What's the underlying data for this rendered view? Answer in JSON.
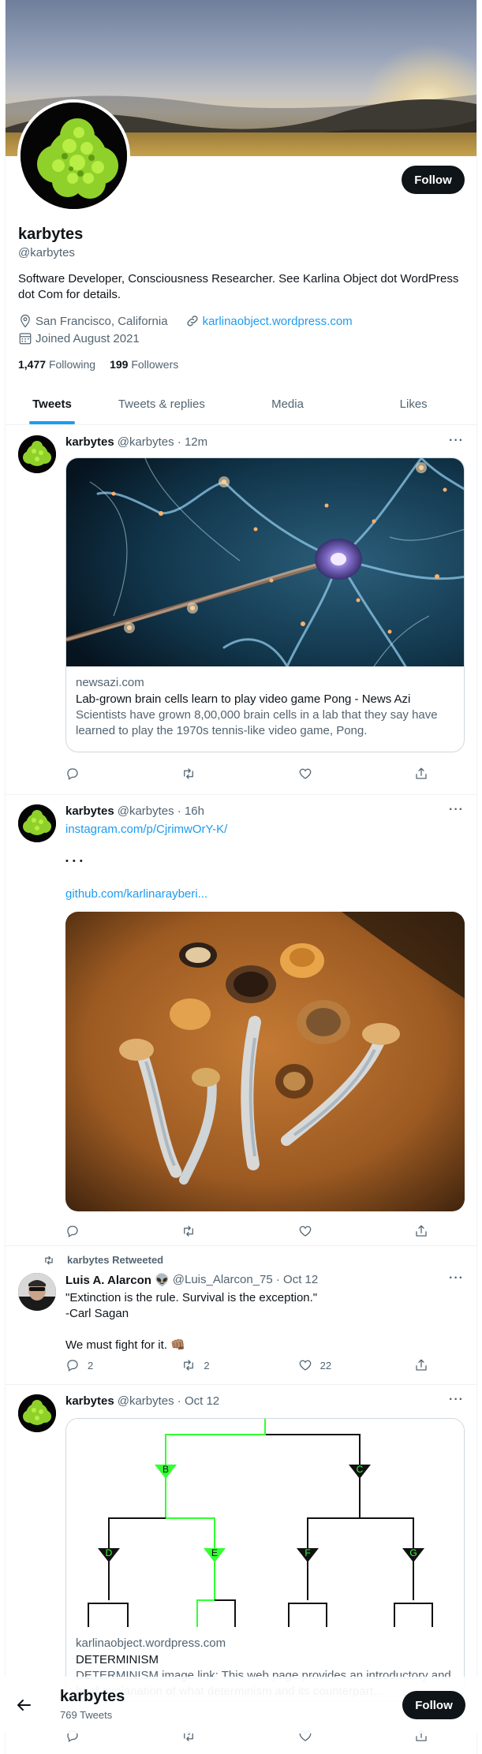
{
  "profile": {
    "name": "karbytes",
    "handle": "@karbytes",
    "bio": "Software Developer, Consciousness Researcher. See Karlina Object dot WordPress dot Com for details.",
    "location": "San Francisco, California",
    "website": "karlinaobject.wordpress.com",
    "joined": "Joined August 2021",
    "following_count": "1,477",
    "following_label": "Following",
    "followers_count": "199",
    "followers_label": "Followers",
    "follow_label": "Follow"
  },
  "tabs": [
    "Tweets",
    "Tweets & replies",
    "Media",
    "Likes"
  ],
  "tweets": [
    {
      "name": "karbytes",
      "handle": "@karbytes · 12m",
      "card_domain": "newsazi.com",
      "card_title": "Lab-grown brain cells learn to play video game Pong - News Azi",
      "card_desc": "Scientists have grown 8,00,000 brain cells in a lab that they say have learned to play the 1970s tennis-like video game, Pong."
    },
    {
      "name": "karbytes",
      "handle": "@karbytes · 16h",
      "link1": "instagram.com/p/CjrimwOrY-K/",
      "dots": "• • •",
      "link2": "github.com/karlinarayberi..."
    },
    {
      "retweet_label": "karbytes Retweeted",
      "name": "Luis A. Alarcon 👽",
      "handle": "@Luis_Alarcon_75 · Oct 12",
      "line1": "\"Extinction is the rule. Survival is the exception.\"",
      "line2": "-Carl Sagan",
      "line3": "We must fight for it. 👊🏽",
      "replies": "2",
      "retweets": "2",
      "likes": "22"
    },
    {
      "name": "karbytes",
      "handle": "@karbytes · Oct 12",
      "card_domain": "karlinaobject.wordpress.com",
      "card_title": "DETERMINISM",
      "card_desc": "DETERMINISM image link: This web page provides an introductory and brief explanation of what determinism and its counterpart...",
      "tree_labels": [
        "B",
        "C",
        "D",
        "E",
        "F",
        "G"
      ]
    }
  ],
  "bottom_bar": {
    "name": "karbytes",
    "tweet_count": "769 Tweets",
    "follow_label": "Follow"
  },
  "colors": {
    "accent": "#1d9bf0",
    "text": "#0f1419",
    "muted": "#536471",
    "tree_highlight": "#33ff33"
  }
}
